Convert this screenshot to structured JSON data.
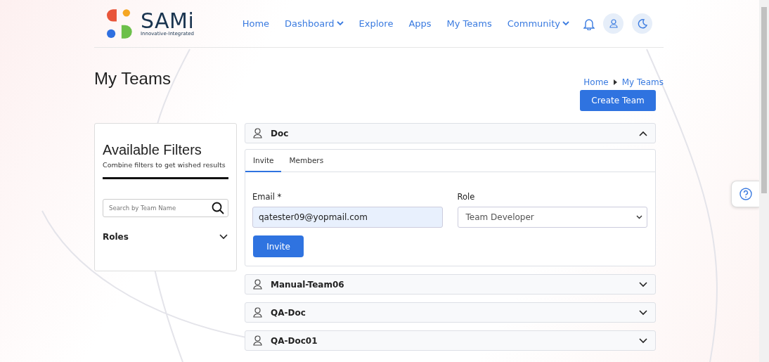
{
  "logo": {
    "name": "SAMi",
    "tagline": "Innovative-Integrated"
  },
  "nav": [
    {
      "label": "Home",
      "dropdown": false
    },
    {
      "label": "Dashboard",
      "dropdown": true
    },
    {
      "label": "Explore",
      "dropdown": false
    },
    {
      "label": "Apps",
      "dropdown": false
    },
    {
      "label": "My Teams",
      "dropdown": false
    },
    {
      "label": "Community",
      "dropdown": true
    }
  ],
  "page_title": "My Teams",
  "breadcrumb": [
    "Home",
    "My Teams"
  ],
  "create_button": "Create Team",
  "filters": {
    "title": "Available Filters",
    "subtitle": "Combine filters to get wished results",
    "search": {
      "placeholder": "Search by Team Name"
    },
    "sections": [
      {
        "label": "Roles",
        "expanded": false
      }
    ]
  },
  "teams": [
    {
      "name": "Doc",
      "expanded": true,
      "tabs": [
        {
          "label": "Invite",
          "selected": true
        },
        {
          "label": "Members",
          "selected": false
        }
      ],
      "email_label": "Email *",
      "email_value": "qatester09@yopmail.com",
      "role_label": "Role",
      "role_value": "Team Developer",
      "invite_button": "Invite"
    },
    {
      "name": "Manual-Team06",
      "expanded": false
    },
    {
      "name": "QA-Doc",
      "expanded": false
    },
    {
      "name": "QA-Doc01",
      "expanded": false
    }
  ]
}
